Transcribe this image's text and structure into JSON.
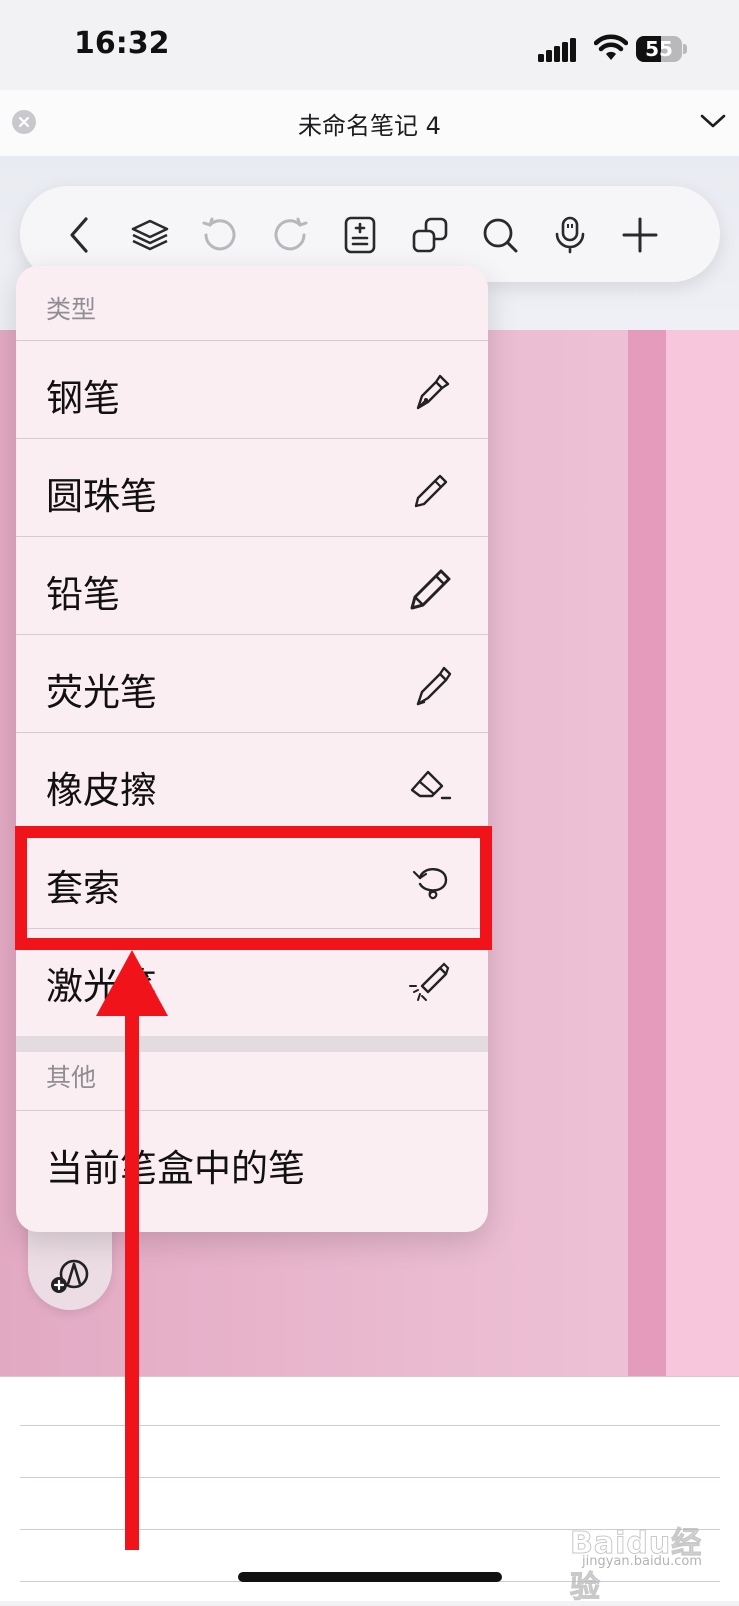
{
  "status_bar": {
    "time": "16:32",
    "battery": "55",
    "battery_level": 0.55
  },
  "title_bar": {
    "title": "未命名笔记 4"
  },
  "toolbar": {
    "icons": [
      "back-chevron-icon",
      "layers-icon",
      "undo-icon",
      "redo-icon",
      "page-template-icon",
      "copy-pages-icon",
      "search-icon",
      "microphone-icon",
      "add-icon"
    ]
  },
  "menu": {
    "section_type_label": "类型",
    "items": [
      {
        "label": "钢笔",
        "icon": "fountain-pen-icon"
      },
      {
        "label": "圆珠笔",
        "icon": "ballpoint-pen-icon"
      },
      {
        "label": "铅笔",
        "icon": "pencil-icon"
      },
      {
        "label": "荧光笔",
        "icon": "highlighter-icon"
      },
      {
        "label": "橡皮擦",
        "icon": "eraser-icon"
      },
      {
        "label": "套索",
        "icon": "lasso-icon"
      },
      {
        "label": "激光笔",
        "icon": "laser-pointer-icon"
      }
    ],
    "section_other_label": "其他",
    "other_item": {
      "label": "当前笔盒中的笔"
    }
  },
  "annotation": {
    "highlight_color": "#f0141a",
    "arrow_color": "#f0141a"
  },
  "watermark": {
    "top": "Baidu经验",
    "bottom": "jingyan.baidu.com"
  },
  "colors": {
    "page_pink": "#eabbd1",
    "menu_bg": "#faeef3"
  }
}
